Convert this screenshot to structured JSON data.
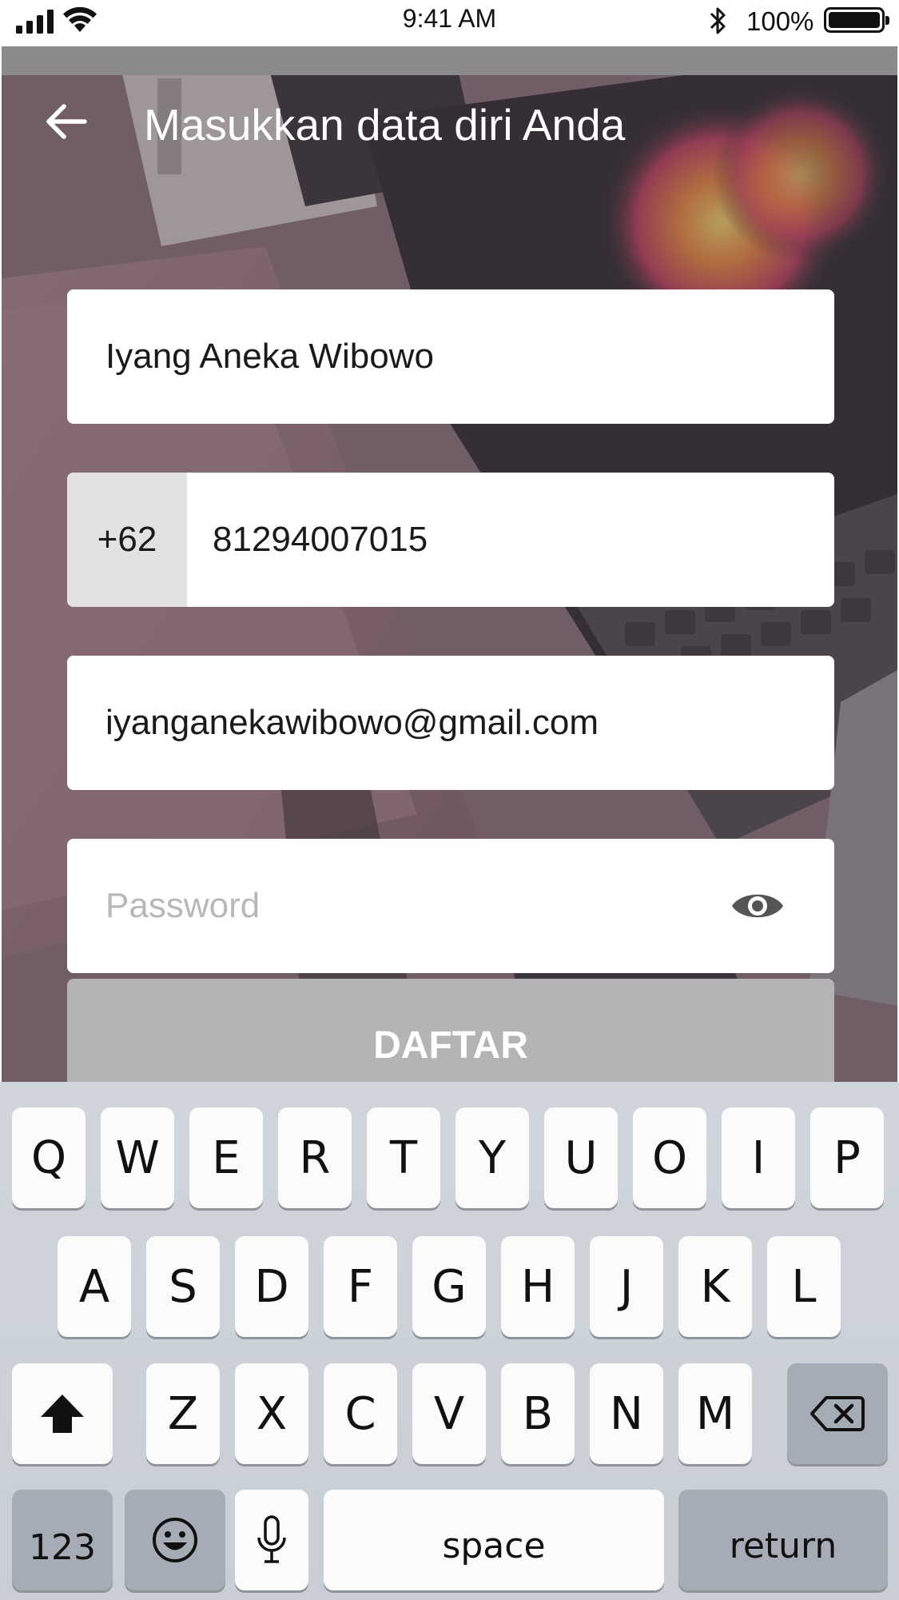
{
  "status_bar": {
    "time": "9:41 AM",
    "battery_percent": "100%",
    "battery_level": 1.0,
    "icons": [
      "signal-bars-icon",
      "wifi-icon",
      "bluetooth-icon",
      "battery-icon"
    ]
  },
  "header": {
    "back_icon": "arrow-left-icon",
    "title": "Masukkan data diri Anda"
  },
  "form": {
    "name_value": "Iyang Aneka Wibowo",
    "phone_prefix": "+62",
    "phone_value": "81294007015",
    "email_value": "iyanganekawibowo@gmail.com",
    "password_value": "",
    "password_placeholder": "Password",
    "password_toggle_icon": "eye-icon",
    "submit_label": "DAFTAR"
  },
  "keyboard": {
    "row1": [
      "Q",
      "W",
      "E",
      "R",
      "T",
      "Y",
      "U",
      "O",
      "I",
      "P"
    ],
    "row2": [
      "A",
      "S",
      "D",
      "F",
      "G",
      "H",
      "J",
      "K",
      "L"
    ],
    "row3": [
      "Z",
      "X",
      "C",
      "V",
      "B",
      "N",
      "M"
    ],
    "shift_icon": "shift-arrow-icon",
    "backspace_icon": "backspace-icon",
    "numbers_label": "123",
    "emoji_icon": "emoji-icon",
    "mic_icon": "microphone-icon",
    "space_label": "space",
    "return_label": "return"
  },
  "colors": {
    "submit_disabled": "#b4b4b4",
    "prefix_bg": "#e2e2e2",
    "keyboard_bg": "#d0d5dc"
  }
}
